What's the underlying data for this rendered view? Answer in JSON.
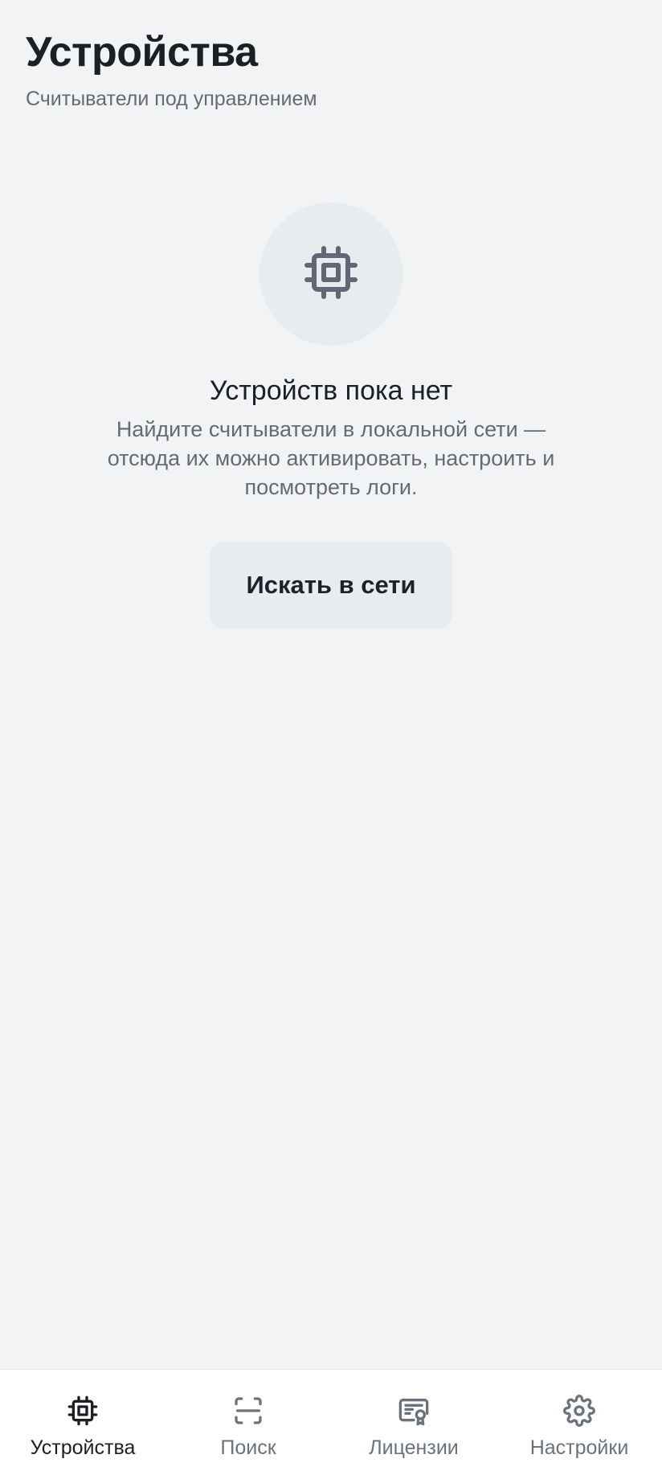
{
  "header": {
    "title": "Устройства",
    "subtitle": "Считыватели под управлением"
  },
  "empty_state": {
    "icon": "chip-icon",
    "title": "Устройств пока нет",
    "description": "Найдите считыватели в локальной сети — отсюда их можно активировать, настроить и посмотреть логи.",
    "button_label": "Искать в сети"
  },
  "bottom_nav": {
    "items": [
      {
        "label": "Устройства",
        "icon": "chip-icon",
        "active": true
      },
      {
        "label": "Поиск",
        "icon": "scan-icon",
        "active": false
      },
      {
        "label": "Лицензии",
        "icon": "certificate-icon",
        "active": false
      },
      {
        "label": "Настройки",
        "icon": "gear-icon",
        "active": false
      }
    ]
  },
  "colors": {
    "background": "#f1f3f5",
    "text_primary": "#1c1f24",
    "text_secondary": "#646b75",
    "icon_muted": "#616875",
    "surface": "#ffffff"
  }
}
